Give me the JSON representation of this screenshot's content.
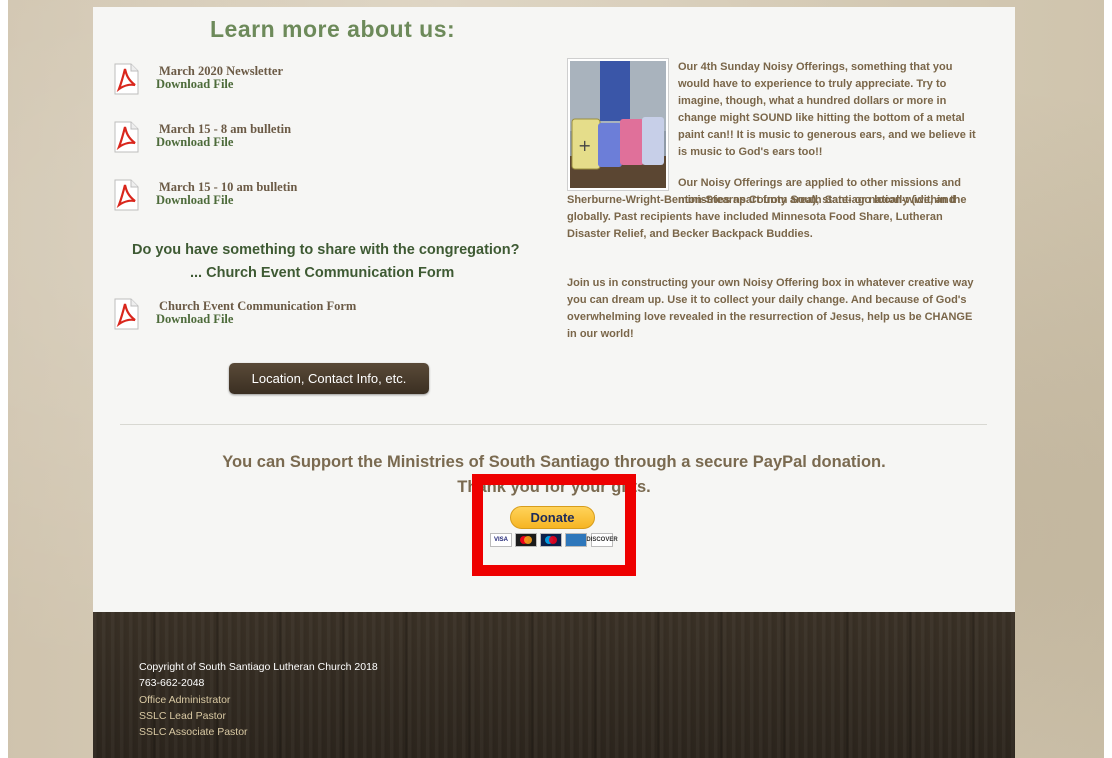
{
  "heading": "Learn more about us:",
  "files": [
    {
      "name": "March 2020 Newsletter",
      "link": "Download File"
    },
    {
      "name": "March 15 - 8 am bulletin",
      "link": "Download File"
    },
    {
      "name": "March 15 - 10 am bulletin",
      "link": "Download File"
    },
    {
      "name": "Church Event Communication Form",
      "link": "Download File"
    }
  ],
  "share_question": "Do you have something to share with the congregation?",
  "share_form_title": "...   Church Event Communication Form",
  "location_button": "Location, Contact Info, etc.",
  "noisy": {
    "para1": "Our 4th Sunday Noisy Offerings, something that you would have to experience to truly appreciate. Try to imagine, though, what a hundred dollars or more in change might SOUND like hitting the bottom of a metal paint can!! It is music to generous ears, and we believe it is music to God's ears too!!",
    "para2a": "Our Noisy Offerings are applied to other missions and ministries apart from South Santiago locally (within the",
    "para2b": "Sherburne-Wright-Benton-Stearns County area), state- or nation-wide, and globally. Past recipients have included Minnesota Food Share, Lutheran Disaster Relief, and Becker Backpack Buddies.",
    "para3": "Join us in constructing your own Noisy Offering box in whatever creative way you can dream up. Use it to collect your daily change. And because of God's overwhelming love revealed in the resurrection of Jesus, help us be CHANGE in our world!"
  },
  "support_text": "You can Support the Ministries of South Santiago through a secure PayPal donation.",
  "thanks_text": "Thank you for your gifts.",
  "donate_label": "Donate",
  "card_icons": [
    "visa-icon",
    "mastercard-icon",
    "maestro-icon",
    "amex-icon",
    "discover-icon"
  ],
  "cards": [
    {
      "label": "VISA",
      "bg": "#ffffff",
      "fg": "#1a1f71"
    },
    {
      "label": "",
      "bg": "#1b1b1b",
      "fg": "#ffffff"
    },
    {
      "label": "",
      "bg": "#0b1f4a",
      "fg": "#ffffff"
    },
    {
      "label": "",
      "bg": "#2e77bb",
      "fg": "#ffffff"
    },
    {
      "label": "DISCOVER",
      "bg": "#ffffff",
      "fg": "#333333"
    }
  ],
  "footer": {
    "copyright": "Copyright of South Santiago Lutheran Church 2018",
    "phone": "763-662-2048",
    "links": [
      "Office Administrator",
      "SSLC Lead Pastor",
      "SSLC Associate Pastor"
    ]
  },
  "colors": {
    "highlight": "#ee0000",
    "accent_green": "#6d8a5a",
    "footer_link": "#d9c9a3"
  }
}
